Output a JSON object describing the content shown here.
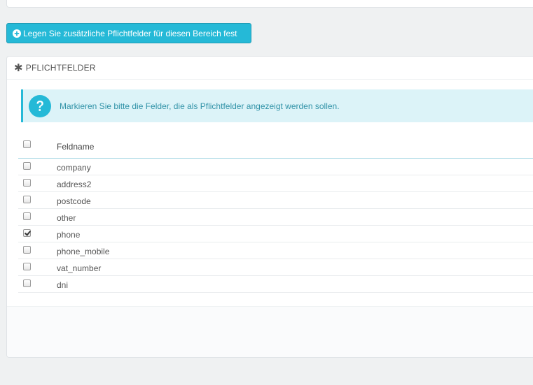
{
  "toolbar": {
    "add_required_label": "Legen Sie zusätzliche Pflichtfelder für diesen Bereich fest",
    "add_icon": "plus-circle-icon"
  },
  "panel": {
    "heading": "PFLICHTFELDER",
    "heading_icon": "asterisk-icon"
  },
  "alert": {
    "icon": "question-circle-icon",
    "text": "Markieren Sie bitte die Felder, die als Pflichtfelder angezeigt werden sollen."
  },
  "table": {
    "header": "Feldname",
    "rows": [
      {
        "label": "company",
        "checked": false
      },
      {
        "label": "address2",
        "checked": false
      },
      {
        "label": "postcode",
        "checked": false
      },
      {
        "label": "other",
        "checked": false
      },
      {
        "label": "phone",
        "checked": true
      },
      {
        "label": "phone_mobile",
        "checked": false
      },
      {
        "label": "vat_number",
        "checked": false
      },
      {
        "label": "dni",
        "checked": false
      }
    ]
  },
  "colors": {
    "accent": "#25b9d7",
    "alert_bg": "#dcf3f8",
    "alert_text": "#3293a8"
  }
}
